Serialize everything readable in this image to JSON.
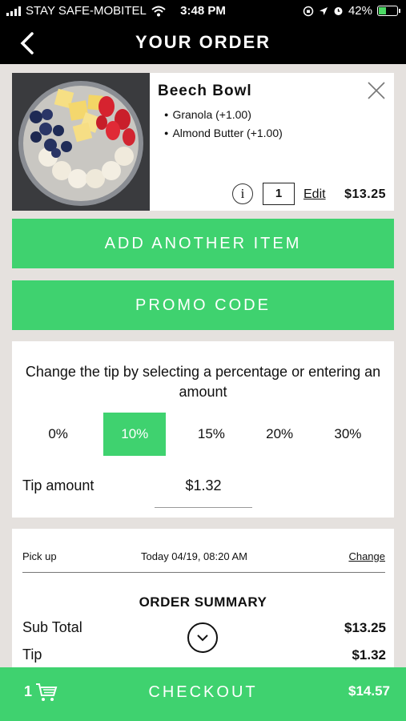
{
  "status_bar": {
    "carrier": "STAY SAFE-MOBITEL",
    "time": "3:48 PM",
    "battery_text": "42%",
    "battery_level": 0.42
  },
  "nav": {
    "title": "YOUR ORDER",
    "back_icon": "chevron-left-icon"
  },
  "item": {
    "name": "Beech Bowl",
    "modifiers": [
      "Granola (+1.00)",
      "Almond Butter (+1.00)"
    ],
    "quantity": "1",
    "info_glyph": "i",
    "edit_label": "Edit",
    "price": "$13.25"
  },
  "buttons": {
    "add_item": "ADD ANOTHER ITEM",
    "promo": "PROMO CODE"
  },
  "tip": {
    "instruction": "Change the tip by selecting a percentage or entering an amount",
    "options": [
      "0%",
      "10%",
      "15%",
      "20%",
      "30%"
    ],
    "selected": "10%",
    "amount_label": "Tip amount",
    "amount_value": "$1.32"
  },
  "pickup": {
    "label": "Pick up",
    "time": "Today 04/19, 08:20 AM",
    "change_label": "Change"
  },
  "summary": {
    "title": "ORDER SUMMARY",
    "rows": [
      {
        "label": "Sub Total",
        "value": "$13.25"
      },
      {
        "label": "Tip",
        "value": "$1.32"
      }
    ]
  },
  "checkout": {
    "count": "1",
    "label": "CHECKOUT",
    "total": "$14.57"
  },
  "colors": {
    "accent": "#3fd26f",
    "background": "#e5e1de",
    "bar": "#000000"
  }
}
